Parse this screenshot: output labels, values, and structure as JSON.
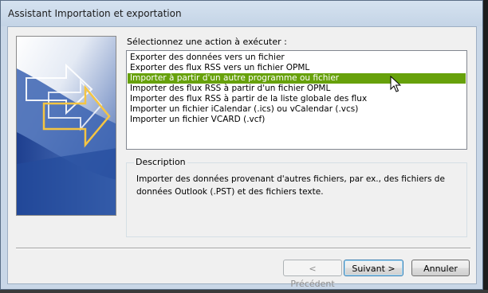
{
  "window": {
    "title": "Assistant Importation et exportation"
  },
  "wizard": {
    "prompt": "Sélectionnez une action à exécuter :",
    "actions": [
      "Exporter des données vers un fichier",
      "Exporter des flux RSS vers un fichier OPML",
      "Importer à partir d'un autre programme ou fichier",
      "Importer des flux RSS à partir d'un fichier OPML",
      "Importer des flux RSS à partir de la liste globale des flux",
      "Importer un fichier iCalendar (.ics) ou vCalendar (.vcs)",
      "Importer un fichier VCARD (.vcf)"
    ],
    "selected_index": 2
  },
  "description": {
    "legend": "Description",
    "text": "Importer des données provenant d'autres fichiers, par ex., des fichiers de données Outlook (.PST) et des fichiers texte."
  },
  "buttons": {
    "back": "< Précédent",
    "next": "Suivant >",
    "cancel": "Annuler"
  },
  "colors": {
    "selection": "#67a10b",
    "titlebar": "#c9d7e7",
    "client_bg": "#f0f0f0"
  }
}
